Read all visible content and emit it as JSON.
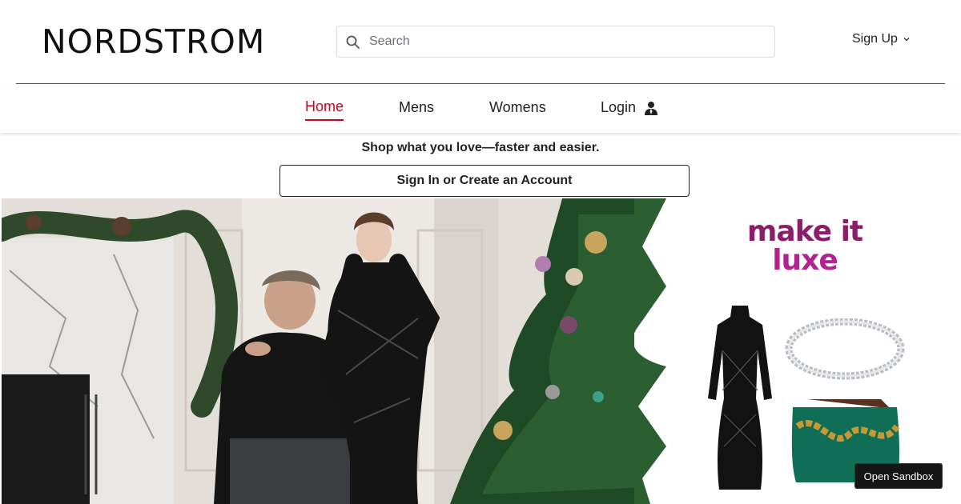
{
  "brand": {
    "logo_text": "NORDSTROM"
  },
  "search": {
    "placeholder": "Search",
    "value": "",
    "icon": "search-icon"
  },
  "account": {
    "signup_label": "Sign Up",
    "signup_icon": "chevron-down-icon"
  },
  "nav": {
    "items": [
      {
        "label": "Home",
        "active": true
      },
      {
        "label": "Mens",
        "active": false
      },
      {
        "label": "Womens",
        "active": false
      },
      {
        "label": "Login",
        "active": false,
        "icon": "user-icon"
      }
    ],
    "active_color": "#d0021b"
  },
  "promo": {
    "headline": "Shop what you love—faster and easier.",
    "signin_button": "Sign In or Create an Account"
  },
  "hero": {
    "tagline_line1": "make it",
    "tagline_line2": "luxe"
  },
  "sandbox_button": "Open Sandbox"
}
